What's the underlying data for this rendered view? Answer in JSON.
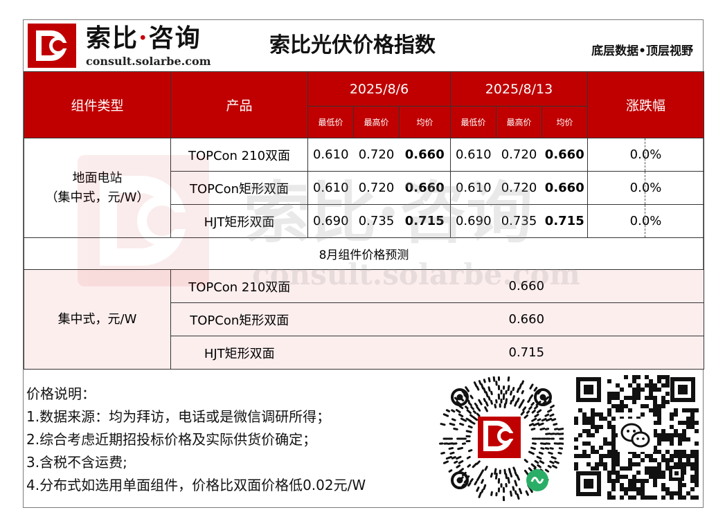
{
  "header": {
    "brand_cn_left": "索比",
    "brand_cn_dot": "·",
    "brand_cn_right": "咨询",
    "brand_en": "consult.solarbe.com",
    "title": "索比光伏价格指数",
    "slogan": "底层数据•顶层视野"
  },
  "table": {
    "col_module_type": "组件类型",
    "col_product": "产品",
    "date1": "2025/8/6",
    "date2": "2025/8/13",
    "col_change": "涨跌幅",
    "sub_low": "最低价",
    "sub_high": "最高价",
    "sub_avg": "均价",
    "group1_line1": "地面电站",
    "group1_line2": "（集中式，元/W）",
    "rows": [
      {
        "product": "TOPCon 210双面",
        "d1_low": "0.610",
        "d1_high": "0.720",
        "d1_avg": "0.660",
        "d2_low": "0.610",
        "d2_high": "0.720",
        "d2_avg": "0.660",
        "change": "0.0%"
      },
      {
        "product": "TOPCon矩形双面",
        "d1_low": "0.610",
        "d1_high": "0.720",
        "d1_avg": "0.660",
        "d2_low": "0.610",
        "d2_high": "0.720",
        "d2_avg": "0.660",
        "change": "0.0%"
      },
      {
        "product": "HJT矩形双面",
        "d1_low": "0.690",
        "d1_high": "0.735",
        "d1_avg": "0.715",
        "d2_low": "0.690",
        "d2_high": "0.735",
        "d2_avg": "0.715",
        "change": "0.0%"
      }
    ],
    "forecast_title": "8月组件价格预测",
    "group2_label": "集中式，元/W",
    "forecast_rows": [
      {
        "product": "TOPCon 210双面",
        "price": "0.660"
      },
      {
        "product": "TOPCon矩形双面",
        "price": "0.660"
      },
      {
        "product": "HJT矩形双面",
        "price": "0.715"
      }
    ]
  },
  "notes": {
    "heading": "价格说明：",
    "items": [
      "1.数据来源：均为拜访，电话或是微信调研所得；",
      "2.综合考虑近期招投标价格及实际供货价确定；",
      "3.含税不含运费;",
      "4.分布式如选用单面组件，价格比双面价格低0.02元/W"
    ]
  },
  "watermark": {
    "cn": "索比·咨询",
    "en": "consult.solarbe.com"
  },
  "colors": {
    "brand_red": "#c00000",
    "pink_bg": "#fdeeee",
    "wechat_green": "#2aae67"
  },
  "icons": [
    "solarbe-logo-icon",
    "mini-program-qr-icon",
    "wechat-qr-icon"
  ]
}
